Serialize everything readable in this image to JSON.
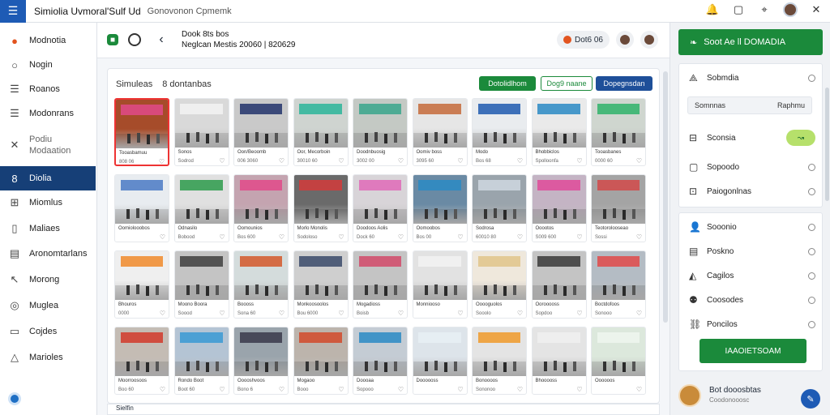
{
  "window": {
    "title": "Simiolia Uvmoral'Sulf Ud",
    "subtitle": "Gonovonon Cpmemk"
  },
  "sidebar": {
    "items": [
      {
        "label": "Modnotia",
        "icon": "fire-icon"
      },
      {
        "label": "Nogin",
        "icon": "circle-icon"
      },
      {
        "label": "Roanos",
        "icon": "list-icon"
      },
      {
        "label": "Modonrans",
        "icon": "list-icon"
      },
      {
        "label": "Podiu\nModaation",
        "icon": "tools-icon"
      },
      {
        "label": "Diolia",
        "icon": "shape-icon",
        "active": true
      },
      {
        "label": "Miomlus",
        "icon": "grid-icon"
      },
      {
        "label": "Maliaes",
        "icon": "phone-icon"
      },
      {
        "label": "Aronomtarlans",
        "icon": "document-icon"
      },
      {
        "label": "Morong",
        "icon": "arrow-icon"
      },
      {
        "label": "Muglea",
        "icon": "compass-icon"
      },
      {
        "label": "Cojdes",
        "icon": "box-icon"
      },
      {
        "label": "Marioles",
        "icon": "triangle-icon"
      }
    ]
  },
  "toolbar": {
    "title_line1": "Dook 8ts bos",
    "title_line2": "Neglcan Mestis 20060 | 820629",
    "pill_label": "Dot6 06"
  },
  "content": {
    "tabs": [
      "Simuleas",
      "8 dontanbas"
    ],
    "btn_green": "Dotolidlhom",
    "btn_outline": "Dog9 naane",
    "btn_blue": "Dopegnsdan",
    "footer_label": "Sielfin"
  },
  "cards": [
    {
      "lbl": "Tooasbamuu",
      "sub": "808 06",
      "img": "#e04a8a,#a64c2a"
    },
    {
      "lbl": "Sonos",
      "sub": "Sodrod",
      "img": "#f2f2f2,#d9d9d9"
    },
    {
      "lbl": "Oon/Beoomb",
      "sub": "006 3060",
      "img": "#22326b,#c9c9c9"
    },
    {
      "lbl": "Oor, Mecorboin",
      "sub": "30010 60",
      "img": "#2bb59a,#cfd4d0"
    },
    {
      "lbl": "Doodnbuosig",
      "sub": "3002 00",
      "img": "#3aa68c,#c4c9c4"
    },
    {
      "lbl": "Oomiv boss",
      "sub": "3095 60",
      "img": "#c46a3a,#e6e6e6"
    },
    {
      "lbl": "Modo",
      "sub": "Bos 68",
      "img": "#1f5aaf,#e9ecef"
    },
    {
      "lbl": "Bhobbiclos",
      "sub": "Spolloonfa",
      "img": "#2a8ac4,#eaeaea"
    },
    {
      "lbl": "Tooasbanes",
      "sub": "0000 60",
      "img": "#2fb36a,#cfd6cf"
    },
    {
      "lbl": "Oomiolooobos",
      "sub": "",
      "img": "#4a7ac4,#e8ecf0"
    },
    {
      "lbl": "Odnasilo",
      "sub": "Bobood",
      "img": "#2c9a4a,#e0e0e0"
    },
    {
      "lbl": "Oomounios",
      "sub": "Bos 600",
      "img": "#e24a8a,#c4a4b0"
    },
    {
      "lbl": "Morlo Monolis",
      "sub": "Sodoloso",
      "img": "#d23a3a,#6a6a6a"
    },
    {
      "lbl": "Doodoos Aolis",
      "sub": "Dock 60",
      "img": "#e06ab8,#d8d4d8"
    },
    {
      "lbl": "Oomoobos",
      "sub": "Bos 00",
      "img": "#2a8ac4,#6a8aa4"
    },
    {
      "lbl": "Sodrosa",
      "sub": "60010 80",
      "img": "#cfd8e0,#9aa4ac"
    },
    {
      "lbl": "Ooootos",
      "sub": "S009 600",
      "img": "#e04a9a,#c4b4c4"
    },
    {
      "lbl": "Teotorolooseao",
      "sub": "Sossi",
      "img": "#d24a4a,#a4a4a4"
    },
    {
      "lbl": "Bhouros",
      "sub": "0000",
      "img": "#f08a2a,#efefef"
    },
    {
      "lbl": "Moono Boora",
      "sub": "Soood",
      "img": "#404040,#c4c4c4"
    },
    {
      "lbl": "Boooss",
      "sub": "Sona 60",
      "img": "#d4582a,#d4dcdc"
    },
    {
      "lbl": "Monkoosoolos",
      "sub": "Bou 6000",
      "img": "#3a4a6a,#cfcfcf"
    },
    {
      "lbl": "Mogadioss",
      "sub": "Boisb",
      "img": "#d24a6a,#c4c4c4"
    },
    {
      "lbl": "Monniooso",
      "sub": "",
      "img": "#f2f2f2,#e2e2e2"
    },
    {
      "lbl": "Ooooguolos",
      "sub": "Sooolo",
      "img": "#e0c48a,#efe8dc"
    },
    {
      "lbl": "Oorooooss",
      "sub": "Sopdoo",
      "img": "#3a3a3a,#c4c4c4"
    },
    {
      "lbl": "Boctdofoos",
      "sub": "Sonooo",
      "img": "#e04a4a,#b4bcc4"
    },
    {
      "lbl": "Moorroosoos",
      "sub": "Boo 60",
      "img": "#d23a2a,#c4bcb4"
    },
    {
      "lbl": "Rondo Boot",
      "sub": "Boot 60",
      "img": "#3a9ad4,#b4c4d4"
    },
    {
      "lbl": "Ooooshvoos",
      "sub": "Bono 6",
      "img": "#3a3a4a,#9aa4ac"
    },
    {
      "lbl": "Mogaoo",
      "sub": "Booo",
      "img": "#d24a2a,#bcb4ac"
    },
    {
      "lbl": "Doooaa",
      "sub": "Sopooo",
      "img": "#2a8ac4,#c4ccd4"
    },
    {
      "lbl": "Doooooss",
      "sub": "",
      "img": "#e8f0f4,#dde4ea"
    },
    {
      "lbl": "Bonoooos",
      "sub": "Sononoo",
      "img": "#f09a2a,#e4e4e4"
    },
    {
      "lbl": "Bhooooss",
      "sub": "",
      "img": "#f0f0f0,#e4e4e4"
    },
    {
      "lbl": "Oooooos",
      "sub": "",
      "img": "#eef6ee,#dce8dc"
    }
  ],
  "rpanel": {
    "head_label": "Soot  Ae ll  DOMADIA",
    "rows1": [
      {
        "label": "Sobmdia",
        "icon": "triangle-icon"
      },
      {
        "label": "Sconsia",
        "icon": "doc-icon"
      },
      {
        "label": "Sopoodo",
        "icon": "folder-icon"
      },
      {
        "label": "Paiogonlnas",
        "icon": "columns-icon"
      }
    ],
    "field_left": "Somnnas",
    "field_right": "Raphmu",
    "rows2": [
      {
        "label": "Sooonio",
        "icon": "user-icon"
      },
      {
        "label": "Poskno",
        "icon": "doc-icon"
      },
      {
        "label": "Cagilos",
        "icon": "drop-icon"
      },
      {
        "label": "Coosodes",
        "icon": "group-icon"
      },
      {
        "label": "Poncilos",
        "icon": "link-icon"
      }
    ],
    "action_button": "IAAOIETSOAM",
    "footer_name": "Bot  dooosbtas",
    "footer_sub": "Coodonooosc"
  },
  "colors": {
    "accent_green": "#1b8a3b",
    "nav_active": "#163f77",
    "accent_blue": "#1e4f99"
  }
}
